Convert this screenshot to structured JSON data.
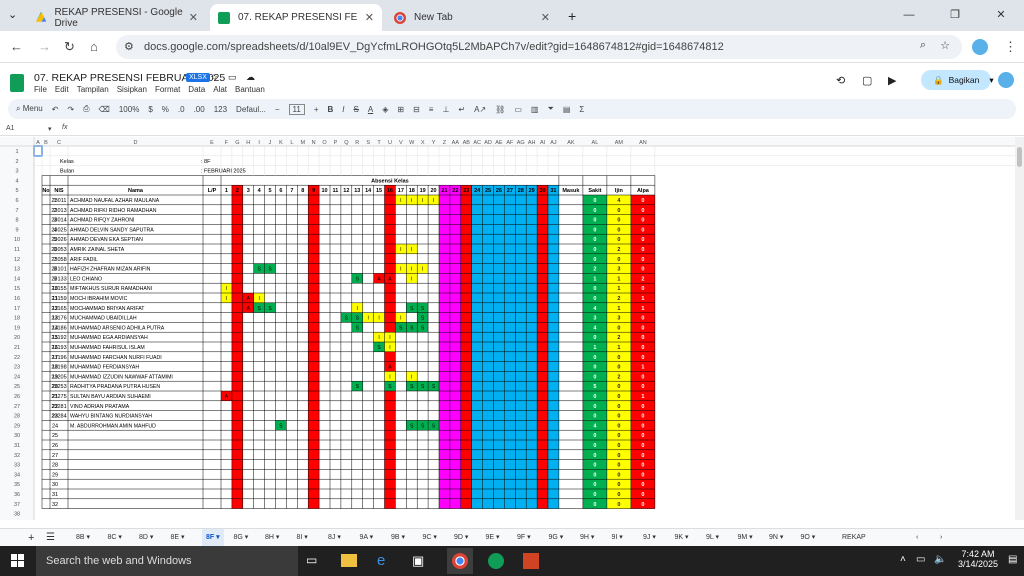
{
  "tabs": [
    {
      "label": "REKAP PRESENSI - Google Drive",
      "icon": "google-drive-icon",
      "active": false
    },
    {
      "label": "07. REKAP PRESENSI FEBRUARI",
      "icon": "google-sheets-icon",
      "active": true
    },
    {
      "label": "New Tab",
      "icon": "chrome-icon",
      "active": false
    }
  ],
  "url": "docs.google.com/spreadsheets/d/10al9EV_DgYcfmLROHGOtq5L2MbAPCh7v/edit?gid=1648674812#gid=1648674812",
  "doc": {
    "title": "07. REKAP PRESENSI FEBRUARI 2025",
    "badge": "XLSX",
    "menus": [
      "File",
      "Edit",
      "Tampilan",
      "Sisipkan",
      "Format",
      "Data",
      "Alat",
      "Bantuan"
    ],
    "share": "Bagikan"
  },
  "toolbar": {
    "menu": "Menu",
    "zoom": "100%",
    "font": "Defaul...",
    "size": "11",
    "currency": "$",
    "percent": "%"
  },
  "cellref": "A1",
  "sheet": {
    "columns": [
      "A",
      "B",
      "C",
      "D",
      "E",
      "F",
      "G",
      "H",
      "I",
      "J",
      "K",
      "L",
      "M",
      "N",
      "O",
      "P",
      "Q",
      "R",
      "S",
      "T",
      "U",
      "V",
      "W",
      "X",
      "Y",
      "Z",
      "AA",
      "AB",
      "AC",
      "AD",
      "AE",
      "AF",
      "AG",
      "AH",
      "AI",
      "AJ",
      "AK",
      "AL",
      "AM",
      "AN"
    ],
    "kelas_label": "Kelas",
    "kelas_value": ": 8F",
    "bulan_label": "Bulan",
    "bulan_value": ": FEBRUARI 2025",
    "absensi_label": "Absensi Kelas",
    "headers": {
      "no": "No",
      "nis": "NIS",
      "nama": "Nama",
      "lp": "L/P",
      "masuk": "Masuk",
      "sakit": "Sakit",
      "ijin": "Ijin",
      "alpa": "Alpa"
    },
    "days": [
      "1",
      "2",
      "3",
      "4",
      "5",
      "6",
      "7",
      "8",
      "9",
      "10",
      "11",
      "12",
      "13",
      "14",
      "15",
      "16",
      "17",
      "18",
      "19",
      "20",
      "21",
      "22",
      "23",
      "24",
      "25",
      "26",
      "27",
      "28",
      "29",
      "30",
      "31"
    ],
    "day_colors": [
      "#ffffff",
      "#ff0000",
      "#ffffff",
      "#ffffff",
      "#ffffff",
      "#ffffff",
      "#ffffff",
      "#ffffff",
      "#ff0000",
      "#ffffff",
      "#ffffff",
      "#ffffff",
      "#ffffff",
      "#ffffff",
      "#ffffff",
      "#ff0000",
      "#ffffff",
      "#ffffff",
      "#ffffff",
      "#ffffff",
      "#ff00ff",
      "#ff00ff",
      "#ff0000",
      "#00b0f0",
      "#00b0f0",
      "#00b0f0",
      "#00b0f0",
      "#00b0f0",
      "#00b0f0",
      "#ff0000",
      "#00b0f0"
    ],
    "students": [
      {
        "no": "1",
        "nis": "23011",
        "name": "ACHMAD NAUFAL AZHAR MAULANA",
        "marks": {
          "17": "I",
          "18": "I",
          "19": "I",
          "20": "I"
        },
        "sakit": "0",
        "ijin": "4",
        "alpa": "0"
      },
      {
        "no": "2",
        "nis": "23013",
        "name": "ACHMAD RIFKI RIDHO RAMADHAN",
        "marks": {},
        "sakit": "0",
        "ijin": "0",
        "alpa": "0"
      },
      {
        "no": "3",
        "nis": "23014",
        "name": "ACHMAD RIFQY ZAHRONI",
        "marks": {},
        "sakit": "0",
        "ijin": "0",
        "alpa": "0"
      },
      {
        "no": "4",
        "nis": "23025",
        "name": "AHMAD DELVIN SANDY SAPUTRA",
        "marks": {},
        "sakit": "0",
        "ijin": "0",
        "alpa": "0"
      },
      {
        "no": "5",
        "nis": "23026",
        "name": "AHMAD DEVAN EKA SEPTIAN",
        "marks": {},
        "sakit": "0",
        "ijin": "0",
        "alpa": "0"
      },
      {
        "no": "6",
        "nis": "23053",
        "name": "AMRIK ZAINAL SHETA",
        "marks": {
          "17": "I",
          "18": "I"
        },
        "sakit": "0",
        "ijin": "2",
        "alpa": "0"
      },
      {
        "no": "7",
        "nis": "23058",
        "name": "ARIF FADIL",
        "marks": {},
        "sakit": "0",
        "ijin": "0",
        "alpa": "0"
      },
      {
        "no": "8",
        "nis": "23101",
        "name": "HAFIZH ZHAFRAN MIZAN ARIFIN",
        "marks": {
          "4": "S",
          "5": "S",
          "17": "I",
          "18": "I",
          "19": "I"
        },
        "sakit": "2",
        "ijin": "3",
        "alpa": "0"
      },
      {
        "no": "9",
        "nis": "23133",
        "name": "LEO CHIANO",
        "marks": {
          "13": "S",
          "15": "A",
          "16": "A",
          "18": "I"
        },
        "sakit": "1",
        "ijin": "1",
        "alpa": "2"
      },
      {
        "no": "10",
        "nis": "23155",
        "name": "MIFTAKHUS SURUR RAMADHANI",
        "marks": {
          "1": "I"
        },
        "sakit": "0",
        "ijin": "1",
        "alpa": "0"
      },
      {
        "no": "11",
        "nis": "23159",
        "name": "MOCH IBRAHIM MOVIC",
        "marks": {
          "1": "I",
          "3": "A",
          "4": "I"
        },
        "sakit": "0",
        "ijin": "2",
        "alpa": "1"
      },
      {
        "no": "12",
        "nis": "23165",
        "name": "MOCHAMMAD BRIYAN ARIFAT",
        "marks": {
          "3": "A",
          "4": "S",
          "5": "S",
          "13": "I",
          "18": "S",
          "19": "S"
        },
        "sakit": "4",
        "ijin": "1",
        "alpa": "1"
      },
      {
        "no": "13",
        "nis": "23176",
        "name": "MUCHAMMAD UBAIDILLAH",
        "marks": {
          "12": "S",
          "13": "S",
          "14": "I",
          "15": "I",
          "17": "I",
          "19": "S"
        },
        "sakit": "3",
        "ijin": "3",
        "alpa": "0"
      },
      {
        "no": "14",
        "nis": "23186",
        "name": "MUHAMMAD ARSENIO ADHILA PUTRA",
        "marks": {
          "13": "S",
          "17": "S",
          "18": "S",
          "19": "S"
        },
        "sakit": "4",
        "ijin": "0",
        "alpa": "0"
      },
      {
        "no": "15",
        "nis": "23192",
        "name": "MUHAMMAD EGA ARDIANSYAH",
        "marks": {
          "15": "I",
          "16": "I"
        },
        "sakit": "0",
        "ijin": "2",
        "alpa": "0"
      },
      {
        "no": "16",
        "nis": "23193",
        "name": "MUHAMMAD FAHRISUL ISLAM",
        "marks": {
          "15": "S",
          "16": "I"
        },
        "sakit": "1",
        "ijin": "1",
        "alpa": "0"
      },
      {
        "no": "17",
        "nis": "23196",
        "name": "MUHAMMAD FARCHAN NURFI FUADI",
        "marks": {},
        "sakit": "0",
        "ijin": "0",
        "alpa": "0"
      },
      {
        "no": "18",
        "nis": "23198",
        "name": "MUHAMMAD FERDIANSYAH",
        "marks": {
          "16": "A"
        },
        "sakit": "0",
        "ijin": "0",
        "alpa": "1"
      },
      {
        "no": "19",
        "nis": "23205",
        "name": "MUHAMMAD IZZUDIN NAWWAF ATTAMIMI",
        "marks": {
          "16": "I",
          "18": "I"
        },
        "sakit": "0",
        "ijin": "2",
        "alpa": "0"
      },
      {
        "no": "20",
        "nis": "23253",
        "name": "RADHITYA PRADANA PUTRA HUSEN",
        "marks": {
          "13": "S",
          "16": "S",
          "18": "S",
          "19": "S",
          "20": "S"
        },
        "sakit": "5",
        "ijin": "0",
        "alpa": "0"
      },
      {
        "no": "21",
        "nis": "23275",
        "name": "SULTAN BAYU ARDIAN SUHAEMI",
        "marks": {
          "1": "A"
        },
        "sakit": "0",
        "ijin": "0",
        "alpa": "1"
      },
      {
        "no": "22",
        "nis": "23281",
        "name": "VINO ADRIAN PRATAMA",
        "marks": {},
        "sakit": "0",
        "ijin": "0",
        "alpa": "0"
      },
      {
        "no": "23",
        "nis": "23284",
        "name": "WAHYU BINTANG NURDIANSYAH",
        "marks": {},
        "sakit": "0",
        "ijin": "0",
        "alpa": "0"
      },
      {
        "no": "24",
        "nis": "",
        "name": "M. ABDURROHMAN AMIN MAHFUD",
        "marks": {
          "6": "S",
          "18": "S",
          "19": "S",
          "20": "S"
        },
        "sakit": "4",
        "ijin": "0",
        "alpa": "0"
      },
      {
        "no": "25",
        "nis": "",
        "name": "",
        "marks": {},
        "sakit": "0",
        "ijin": "0",
        "alpa": "0"
      },
      {
        "no": "26",
        "nis": "",
        "name": "",
        "marks": {},
        "sakit": "0",
        "ijin": "0",
        "alpa": "0"
      },
      {
        "no": "27",
        "nis": "",
        "name": "",
        "marks": {},
        "sakit": "0",
        "ijin": "0",
        "alpa": "0"
      },
      {
        "no": "28",
        "nis": "",
        "name": "",
        "marks": {},
        "sakit": "0",
        "ijin": "0",
        "alpa": "0"
      },
      {
        "no": "29",
        "nis": "",
        "name": "",
        "marks": {},
        "sakit": "0",
        "ijin": "0",
        "alpa": "0"
      },
      {
        "no": "30",
        "nis": "",
        "name": "",
        "marks": {},
        "sakit": "0",
        "ijin": "0",
        "alpa": "0"
      },
      {
        "no": "31",
        "nis": "",
        "name": "",
        "marks": {},
        "sakit": "0",
        "ijin": "0",
        "alpa": "0"
      },
      {
        "no": "32",
        "nis": "",
        "name": "",
        "marks": {},
        "sakit": "0",
        "ijin": "0",
        "alpa": "0"
      }
    ],
    "mark_colors": {
      "S": "#00b050",
      "I": "#ffff00",
      "A": "#ff0000"
    },
    "summary_colors": {
      "sakit": "#00b050",
      "ijin": "#ffff00",
      "alpa": "#ff0000"
    }
  },
  "sheet_tabs": [
    "8B",
    "8C",
    "8D",
    "8E",
    "8F",
    "8G",
    "8H",
    "8I",
    "8J",
    "9A",
    "9B",
    "9C",
    "9D",
    "9E",
    "9F",
    "9G",
    "9H",
    "9I",
    "9J",
    "9K",
    "9L",
    "9M",
    "9N",
    "9O",
    "REKAP"
  ],
  "active_sheet": "8F",
  "taskbar": {
    "search": "Search the web and Windows",
    "time": "7:42 AM",
    "date": "3/14/2025"
  }
}
